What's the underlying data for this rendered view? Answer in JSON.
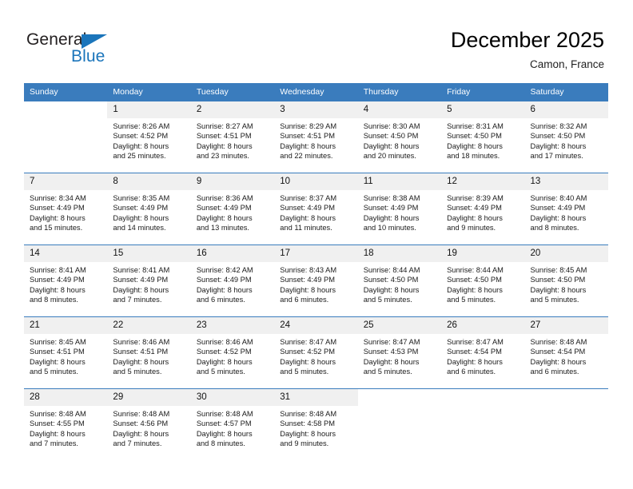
{
  "brand": {
    "name_part1": "General",
    "name_part2": "Blue",
    "accent_color": "#1b75bb"
  },
  "header": {
    "title": "December 2025",
    "subtitle": "Camon, France"
  },
  "theme": {
    "header_row_color": "#3a7cbd",
    "daynum_band_color": "#f0f0f0",
    "grid_line_color": "#3a7cbd"
  },
  "calendar": {
    "weekday_headers": [
      "Sunday",
      "Monday",
      "Tuesday",
      "Wednesday",
      "Thursday",
      "Friday",
      "Saturday"
    ],
    "weeks": [
      [
        {
          "day": "",
          "sunrise": "",
          "sunset": "",
          "daylight_line1": "",
          "daylight_line2": "",
          "blank": true
        },
        {
          "day": "1",
          "sunrise": "Sunrise: 8:26 AM",
          "sunset": "Sunset: 4:52 PM",
          "daylight_line1": "Daylight: 8 hours",
          "daylight_line2": "and 25 minutes."
        },
        {
          "day": "2",
          "sunrise": "Sunrise: 8:27 AM",
          "sunset": "Sunset: 4:51 PM",
          "daylight_line1": "Daylight: 8 hours",
          "daylight_line2": "and 23 minutes."
        },
        {
          "day": "3",
          "sunrise": "Sunrise: 8:29 AM",
          "sunset": "Sunset: 4:51 PM",
          "daylight_line1": "Daylight: 8 hours",
          "daylight_line2": "and 22 minutes."
        },
        {
          "day": "4",
          "sunrise": "Sunrise: 8:30 AM",
          "sunset": "Sunset: 4:50 PM",
          "daylight_line1": "Daylight: 8 hours",
          "daylight_line2": "and 20 minutes."
        },
        {
          "day": "5",
          "sunrise": "Sunrise: 8:31 AM",
          "sunset": "Sunset: 4:50 PM",
          "daylight_line1": "Daylight: 8 hours",
          "daylight_line2": "and 18 minutes."
        },
        {
          "day": "6",
          "sunrise": "Sunrise: 8:32 AM",
          "sunset": "Sunset: 4:50 PM",
          "daylight_line1": "Daylight: 8 hours",
          "daylight_line2": "and 17 minutes."
        }
      ],
      [
        {
          "day": "7",
          "sunrise": "Sunrise: 8:34 AM",
          "sunset": "Sunset: 4:49 PM",
          "daylight_line1": "Daylight: 8 hours",
          "daylight_line2": "and 15 minutes."
        },
        {
          "day": "8",
          "sunrise": "Sunrise: 8:35 AM",
          "sunset": "Sunset: 4:49 PM",
          "daylight_line1": "Daylight: 8 hours",
          "daylight_line2": "and 14 minutes."
        },
        {
          "day": "9",
          "sunrise": "Sunrise: 8:36 AM",
          "sunset": "Sunset: 4:49 PM",
          "daylight_line1": "Daylight: 8 hours",
          "daylight_line2": "and 13 minutes."
        },
        {
          "day": "10",
          "sunrise": "Sunrise: 8:37 AM",
          "sunset": "Sunset: 4:49 PM",
          "daylight_line1": "Daylight: 8 hours",
          "daylight_line2": "and 11 minutes."
        },
        {
          "day": "11",
          "sunrise": "Sunrise: 8:38 AM",
          "sunset": "Sunset: 4:49 PM",
          "daylight_line1": "Daylight: 8 hours",
          "daylight_line2": "and 10 minutes."
        },
        {
          "day": "12",
          "sunrise": "Sunrise: 8:39 AM",
          "sunset": "Sunset: 4:49 PM",
          "daylight_line1": "Daylight: 8 hours",
          "daylight_line2": "and 9 minutes."
        },
        {
          "day": "13",
          "sunrise": "Sunrise: 8:40 AM",
          "sunset": "Sunset: 4:49 PM",
          "daylight_line1": "Daylight: 8 hours",
          "daylight_line2": "and 8 minutes."
        }
      ],
      [
        {
          "day": "14",
          "sunrise": "Sunrise: 8:41 AM",
          "sunset": "Sunset: 4:49 PM",
          "daylight_line1": "Daylight: 8 hours",
          "daylight_line2": "and 8 minutes."
        },
        {
          "day": "15",
          "sunrise": "Sunrise: 8:41 AM",
          "sunset": "Sunset: 4:49 PM",
          "daylight_line1": "Daylight: 8 hours",
          "daylight_line2": "and 7 minutes."
        },
        {
          "day": "16",
          "sunrise": "Sunrise: 8:42 AM",
          "sunset": "Sunset: 4:49 PM",
          "daylight_line1": "Daylight: 8 hours",
          "daylight_line2": "and 6 minutes."
        },
        {
          "day": "17",
          "sunrise": "Sunrise: 8:43 AM",
          "sunset": "Sunset: 4:49 PM",
          "daylight_line1": "Daylight: 8 hours",
          "daylight_line2": "and 6 minutes."
        },
        {
          "day": "18",
          "sunrise": "Sunrise: 8:44 AM",
          "sunset": "Sunset: 4:50 PM",
          "daylight_line1": "Daylight: 8 hours",
          "daylight_line2": "and 5 minutes."
        },
        {
          "day": "19",
          "sunrise": "Sunrise: 8:44 AM",
          "sunset": "Sunset: 4:50 PM",
          "daylight_line1": "Daylight: 8 hours",
          "daylight_line2": "and 5 minutes."
        },
        {
          "day": "20",
          "sunrise": "Sunrise: 8:45 AM",
          "sunset": "Sunset: 4:50 PM",
          "daylight_line1": "Daylight: 8 hours",
          "daylight_line2": "and 5 minutes."
        }
      ],
      [
        {
          "day": "21",
          "sunrise": "Sunrise: 8:45 AM",
          "sunset": "Sunset: 4:51 PM",
          "daylight_line1": "Daylight: 8 hours",
          "daylight_line2": "and 5 minutes."
        },
        {
          "day": "22",
          "sunrise": "Sunrise: 8:46 AM",
          "sunset": "Sunset: 4:51 PM",
          "daylight_line1": "Daylight: 8 hours",
          "daylight_line2": "and 5 minutes."
        },
        {
          "day": "23",
          "sunrise": "Sunrise: 8:46 AM",
          "sunset": "Sunset: 4:52 PM",
          "daylight_line1": "Daylight: 8 hours",
          "daylight_line2": "and 5 minutes."
        },
        {
          "day": "24",
          "sunrise": "Sunrise: 8:47 AM",
          "sunset": "Sunset: 4:52 PM",
          "daylight_line1": "Daylight: 8 hours",
          "daylight_line2": "and 5 minutes."
        },
        {
          "day": "25",
          "sunrise": "Sunrise: 8:47 AM",
          "sunset": "Sunset: 4:53 PM",
          "daylight_line1": "Daylight: 8 hours",
          "daylight_line2": "and 5 minutes."
        },
        {
          "day": "26",
          "sunrise": "Sunrise: 8:47 AM",
          "sunset": "Sunset: 4:54 PM",
          "daylight_line1": "Daylight: 8 hours",
          "daylight_line2": "and 6 minutes."
        },
        {
          "day": "27",
          "sunrise": "Sunrise: 8:48 AM",
          "sunset": "Sunset: 4:54 PM",
          "daylight_line1": "Daylight: 8 hours",
          "daylight_line2": "and 6 minutes."
        }
      ],
      [
        {
          "day": "28",
          "sunrise": "Sunrise: 8:48 AM",
          "sunset": "Sunset: 4:55 PM",
          "daylight_line1": "Daylight: 8 hours",
          "daylight_line2": "and 7 minutes."
        },
        {
          "day": "29",
          "sunrise": "Sunrise: 8:48 AM",
          "sunset": "Sunset: 4:56 PM",
          "daylight_line1": "Daylight: 8 hours",
          "daylight_line2": "and 7 minutes."
        },
        {
          "day": "30",
          "sunrise": "Sunrise: 8:48 AM",
          "sunset": "Sunset: 4:57 PM",
          "daylight_line1": "Daylight: 8 hours",
          "daylight_line2": "and 8 minutes."
        },
        {
          "day": "31",
          "sunrise": "Sunrise: 8:48 AM",
          "sunset": "Sunset: 4:58 PM",
          "daylight_line1": "Daylight: 8 hours",
          "daylight_line2": "and 9 minutes."
        },
        {
          "day": "",
          "sunrise": "",
          "sunset": "",
          "daylight_line1": "",
          "daylight_line2": "",
          "blank": true
        },
        {
          "day": "",
          "sunrise": "",
          "sunset": "",
          "daylight_line1": "",
          "daylight_line2": "",
          "blank": true
        },
        {
          "day": "",
          "sunrise": "",
          "sunset": "",
          "daylight_line1": "",
          "daylight_line2": "",
          "blank": true
        }
      ]
    ]
  }
}
